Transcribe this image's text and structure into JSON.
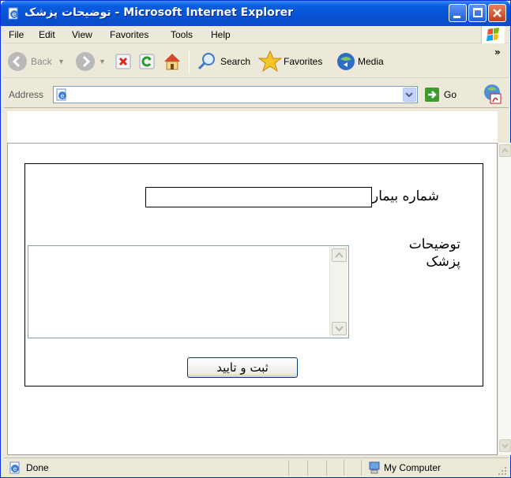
{
  "window": {
    "title": "توضیحات پزشک - Microsoft Internet Explorer"
  },
  "menu": [
    "File",
    "Edit",
    "View",
    "Favorites",
    "Tools",
    "Help"
  ],
  "toolbar": {
    "back_label": "Back",
    "search_label": "Search",
    "favorites_label": "Favorites",
    "media_label": "Media",
    "overflow_label": "»"
  },
  "address": {
    "label": "Address",
    "value": "",
    "go_label": "Go"
  },
  "form": {
    "patient_number_label": "شماره بیمار",
    "patient_number_value": "",
    "description_label": "توضیحات پزشک",
    "description_value": "",
    "submit_label": "ثبت و تایید"
  },
  "status": {
    "text": "Done",
    "zone": "My Computer"
  },
  "colors": {
    "titlebar": "#0752d4",
    "chrome": "#ece9d8",
    "close_button": "#c53e1a"
  }
}
